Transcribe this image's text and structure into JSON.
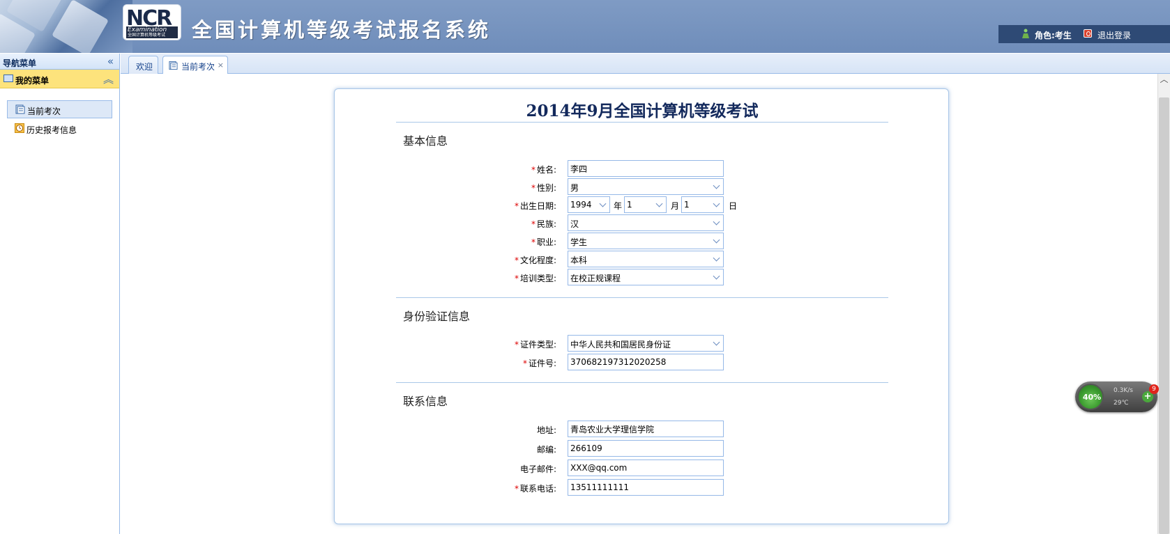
{
  "header": {
    "logo_text": "NCR",
    "logo_sub": "Examination",
    "logo_sub_small": "全国计算机等级考试",
    "title": "全国计算机等级考试报名系统",
    "role_label": "角色:考生",
    "logout_label": "退出登录"
  },
  "nav": {
    "title": "导航菜单",
    "collapse_glyph": "«",
    "menu_title": "我的菜单",
    "menu_toggle_glyph": "︽",
    "items": [
      {
        "label": "当前考次",
        "icon": "document-icon",
        "active": true
      },
      {
        "label": "历史报考信息",
        "icon": "clock-icon",
        "active": false
      }
    ]
  },
  "tabs": [
    {
      "label": "欢迎",
      "active": false
    },
    {
      "label": "当前考次",
      "active": true,
      "close": "×"
    }
  ],
  "form": {
    "title": "2014年9月全国计算机等级考试",
    "sections": {
      "basic": "基本信息",
      "identity": "身份验证信息",
      "contact": "联系信息"
    },
    "required_mark": "*",
    "fields": {
      "name": {
        "label": "姓名:",
        "value": "李四"
      },
      "gender": {
        "label": "性别:",
        "value": "男"
      },
      "birth": {
        "label": "出生日期:",
        "year": "1994",
        "year_unit": "年",
        "month": "1",
        "month_unit": "月",
        "day": "1",
        "day_unit": "日"
      },
      "ethnicity": {
        "label": "民族:",
        "value": "汉"
      },
      "occupation": {
        "label": "职业:",
        "value": "学生"
      },
      "education": {
        "label": "文化程度:",
        "value": "本科"
      },
      "training": {
        "label": "培训类型:",
        "value": "在校正规课程"
      },
      "id_type": {
        "label": "证件类型:",
        "value": "中华人民共和国居民身份证"
      },
      "id_number": {
        "label": "证件号:",
        "value": "370682197312020258"
      },
      "address": {
        "label": "地址:",
        "value": "青岛农业大学理信学院"
      },
      "postcode": {
        "label": "邮编:",
        "value": "266109"
      },
      "email": {
        "label": "电子邮件:",
        "value": "XXX@qq.com"
      },
      "phone": {
        "label": "联系电话:",
        "value": "13511111111"
      }
    }
  },
  "widget": {
    "percent": "40%",
    "speed": "0.3K/s",
    "temperature": "29℃",
    "plus": "+",
    "badge": "9"
  },
  "colors": {
    "header_bg": "#7f9bc4",
    "user_bar": "#2e4a75",
    "menu_highlight": "#fde37c",
    "border_blue": "#99bbe8",
    "title_navy": "#13295c",
    "required_red": "#dd0000"
  }
}
